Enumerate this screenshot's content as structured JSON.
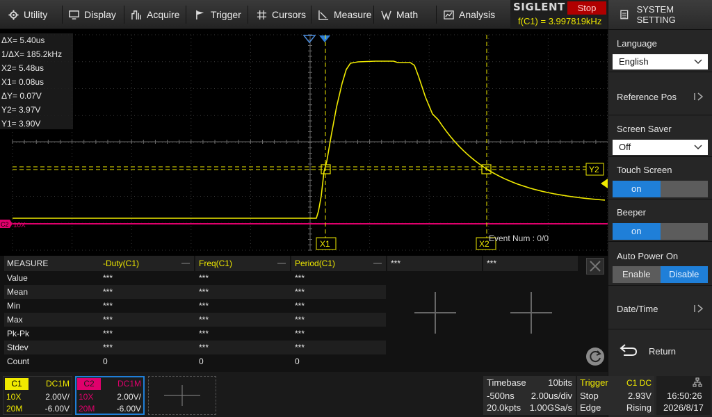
{
  "menu": {
    "utility": "Utility",
    "display": "Display",
    "acquire": "Acquire",
    "trigger": "Trigger",
    "cursors": "Cursors",
    "measure": "Measure",
    "math": "Math",
    "analysis": "Analysis"
  },
  "brand": {
    "logo": "SIGLENT",
    "run_state": "Stop",
    "freq_counter": "f(C1) = 3.997819kHz"
  },
  "panel": {
    "title": "SYSTEM SETTING",
    "language_label": "Language",
    "language_value": "English",
    "reference_pos_label": "Reference Pos",
    "screen_saver_label": "Screen Saver",
    "screen_saver_value": "Off",
    "touch_screen_label": "Touch Screen",
    "touch_screen_on": "on",
    "beeper_label": "Beeper",
    "beeper_on": "on",
    "auto_power_label": "Auto Power On",
    "auto_power_enable": "Enable",
    "auto_power_disable": "Disable",
    "datetime_label": "Date/Time",
    "return_label": "Return"
  },
  "cursors": {
    "dx": "ΔX= 5.40us",
    "inv_dx": "1/ΔX= 185.2kHz",
    "x2": "X2= 5.48us",
    "x1": "X1= 0.08us",
    "dy": "ΔY= 0.07V",
    "y2": "Y2= 3.97V",
    "y1": "Y1= 3.90V",
    "x1_tag": "X1",
    "x2_tag": "X2",
    "y2_tag": "Y2"
  },
  "scope": {
    "event_num": "Event Num : 0/0",
    "c2_tag": "C2",
    "c2_probe": "10X"
  },
  "measure": {
    "title": "MEASURE",
    "headers": [
      "-Duty(C1)",
      "Freq(C1)",
      "Period(C1)",
      "***",
      "***"
    ],
    "rows": [
      {
        "label": "Value",
        "v": [
          "***",
          "***",
          "***"
        ]
      },
      {
        "label": "Mean",
        "v": [
          "***",
          "***",
          "***"
        ]
      },
      {
        "label": "Min",
        "v": [
          "***",
          "***",
          "***"
        ]
      },
      {
        "label": "Max",
        "v": [
          "***",
          "***",
          "***"
        ]
      },
      {
        "label": "Pk-Pk",
        "v": [
          "***",
          "***",
          "***"
        ]
      },
      {
        "label": "Stdev",
        "v": [
          "***",
          "***",
          "***"
        ]
      },
      {
        "label": "Count",
        "v": [
          "0",
          "0",
          "0"
        ]
      }
    ]
  },
  "channels": {
    "c1": {
      "name": "C1",
      "coupling": "DC1M",
      "probe": "10X",
      "scale": "2.00V/",
      "bw": "20M",
      "offset": "-6.00V"
    },
    "c2": {
      "name": "C2",
      "coupling": "DC1M",
      "probe": "10X",
      "scale": "2.00V/",
      "bw": "20M",
      "offset": "-6.00V"
    }
  },
  "timebase": {
    "title": "Timebase",
    "bits": "10bits",
    "delay": "-500ns",
    "scale": "2.00us/div",
    "points": "20.0kpts",
    "rate": "1.00GSa/s"
  },
  "trigger": {
    "title": "Trigger",
    "source": "C1 DC",
    "state": "Stop",
    "level": "2.93V",
    "type": "Edge",
    "slope": "Rising"
  },
  "clock": {
    "time": "16:50:26",
    "date": "2026/8/17"
  },
  "colors": {
    "ch1": "#f0ea00",
    "ch2": "#e0006c",
    "accent": "#1f7fd8",
    "stop": "#b00000"
  }
}
